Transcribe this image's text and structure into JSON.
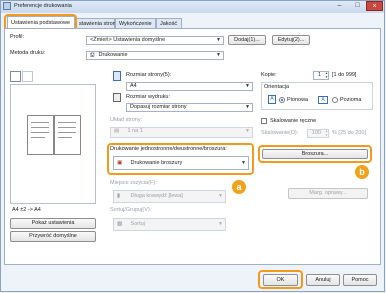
{
  "window": {
    "title": "Preferencje drukowania"
  },
  "tabs": [
    {
      "label": "Ustawienia podstawowe",
      "active": true
    },
    {
      "label": "stawienia strony",
      "active": false
    },
    {
      "label": "Wykończenie",
      "active": false
    },
    {
      "label": "Jakość",
      "active": false
    }
  ],
  "profile": {
    "label": "Profil:",
    "value": "<Zmień> Ustawienia domyślne",
    "add_label": "Dodaj(1)...",
    "edit_label": "Edytuj(2)..."
  },
  "print_method": {
    "label": "Metoda druku:",
    "value": "Drukowanie"
  },
  "paper": {
    "size_label": "Rozmiar strony(5):",
    "size_value": "A4",
    "output_label": "Rozmiar wydruku:",
    "output_value": "Dopasuj rozmiar strony"
  },
  "page_layout": {
    "label": "Układ strony:",
    "value": "1 na 1"
  },
  "duplex": {
    "label": "Drukowanie jednostronne/dwustronne/broszura:",
    "value": "Drukowanie broszury",
    "booklet_button": "Broszura..."
  },
  "binding": {
    "label": "Miejsce zszycia(F):",
    "value": "Długa krawędź [lewa]",
    "margin_button": "Marg. oprawy..."
  },
  "collate": {
    "label": "Sortuj/Grupuj(V):",
    "value": "Sortuj"
  },
  "copies": {
    "label": "Kopie:",
    "value": "1",
    "range": "[1 do 999]"
  },
  "orientation": {
    "label": "Orientacja",
    "portrait": "Pionowa",
    "landscape": "Pozioma",
    "selected": "Pionowa"
  },
  "manual_scaling": {
    "label": "Skalowanie ręczne",
    "checked": false
  },
  "scaling": {
    "label": "Skalowanie(D):",
    "value": "100",
    "range": "% [25 do 200]"
  },
  "preview": {
    "caption": "A4 ±2 -> A4"
  },
  "left_buttons": {
    "view_settings": "Pokaż ustawienia",
    "restore_defaults": "Przywróć domyślne"
  },
  "footer": {
    "ok": "OK",
    "cancel": "Anuluj",
    "help": "Pomoc"
  },
  "callouts": {
    "a": "a",
    "b": "b"
  },
  "colors": {
    "highlight": "#f39a1c",
    "badge": "#f0a21c"
  }
}
